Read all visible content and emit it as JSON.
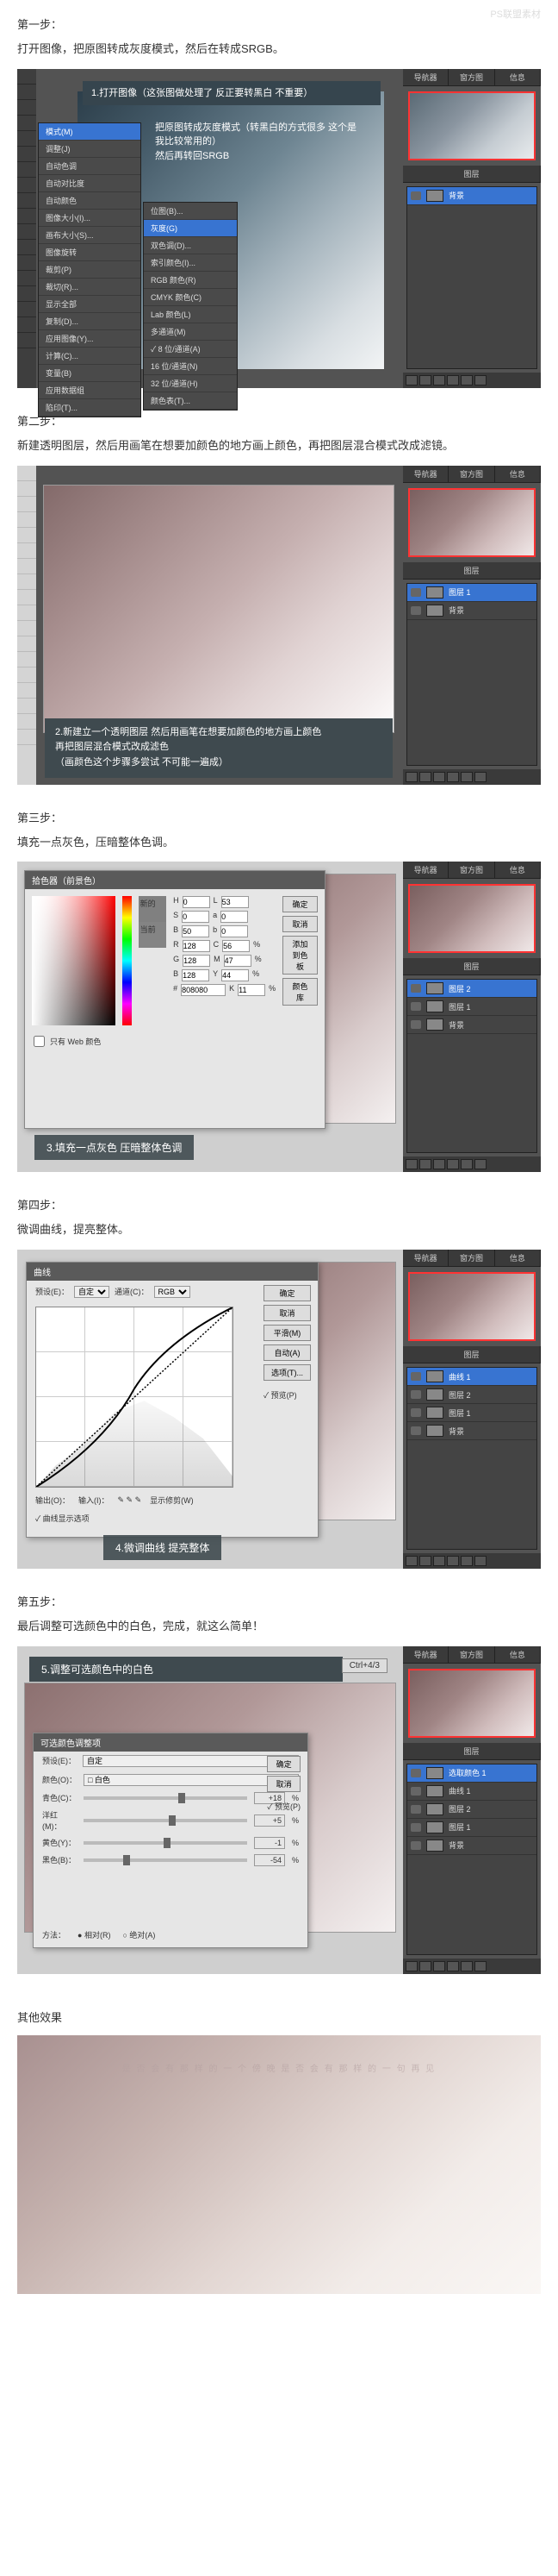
{
  "watermark": "PS联盟素材",
  "steps": [
    {
      "title": "第一步：",
      "desc": "打开图像，把原图转成灰度模式，然后在转成SRGB。",
      "annot1": "1.打开图像（这张图做处理了 反正要转黑白 不重要）",
      "annot2_line1": "把原图转成灰度模式（转黑白的方式很多 这个是我比较常用的）",
      "annot2_line2": "然后再转回SRGB",
      "menu": [
        "模式(M)",
        "调整(J)",
        "自动色调",
        "自动对比度",
        "自动颜色",
        "图像大小(I)...",
        "画布大小(S)...",
        "图像旋转",
        "裁剪(P)",
        "裁切(R)...",
        "显示全部",
        "复制(D)...",
        "应用图像(Y)...",
        "计算(C)...",
        "变量(B)",
        "应用数据组",
        "陷印(T)..."
      ],
      "submenu": [
        "位图(B)...",
        "灰度(G)",
        "双色调(D)...",
        "索引颜色(I)...",
        "RGB 颜色(R)",
        "CMYK 颜色(C)",
        "Lab 颜色(L)",
        "多通道(M)",
        "✓ 8 位/通道(A)",
        "16 位/通道(N)",
        "32 位/通道(H)",
        "颜色表(T)..."
      ],
      "menu_hl_idx": 0,
      "submenu_hl_idx": 1
    },
    {
      "title": "第二步：",
      "desc": "新建透明图层，然后用画笔在想要加颜色的地方画上颜色，再把图层混合模式改成滤镜。",
      "annot_l1": "2.新建立一个透明图层 然后用画笔在想要加颜色的地方画上颜色",
      "annot_l2": "再把图层混合模式改成滤色",
      "annot_l3": "（画颜色这个步骤多尝试 不可能一遍成）"
    },
    {
      "title": "第三步：",
      "desc": "填充一点灰色，压暗整体色调。",
      "annot": "3.填充一点灰色 压暗整体色调",
      "picker": {
        "title": "拾色器（前景色）",
        "new": "新的",
        "current": "当前",
        "btn_ok": "确定",
        "btn_cancel": "取消",
        "btn_add": "添加到色板",
        "btn_lib": "颜色库",
        "hsb": {
          "H": "0",
          "S": "0",
          "B": "50"
        },
        "lab": {
          "L": "53",
          "a": "0",
          "b": "0"
        },
        "rgb": {
          "R": "128",
          "G": "128",
          "B": "128"
        },
        "cmyk": {
          "C": "56",
          "M": "47",
          "Y": "44",
          "K": "11"
        },
        "hex": "808080",
        "webonly": "只有 Web 颜色"
      }
    },
    {
      "title": "第四步：",
      "desc": "微调曲线，提亮整体。",
      "annot": "4.微调曲线 提亮整体",
      "curves": {
        "title": "曲线",
        "preset": "预设(E)：",
        "preset_val": "自定",
        "channel": "通道(C)：",
        "channel_val": "RGB",
        "btn_ok": "确定",
        "btn_cancel": "取消",
        "btn_smooth": "平滑(M)",
        "btn_auto": "自动(A)",
        "btn_options": "选项(T)...",
        "preview": "✓ 预览(P)",
        "output": "输出(O)：",
        "input": "输入(I)：",
        "show_clip": "显示修剪(W)",
        "curve_opts": "✓ 曲线显示选项"
      }
    },
    {
      "title": "第五步：",
      "desc": "最后调整可选颜色中的白色，完成，就这么简单！",
      "annot": "5.调整可选颜色中的白色",
      "shortcut": "Ctrl+4/3",
      "selcolor": {
        "title": "可选颜色调整项",
        "preset": "预设(E)：",
        "preset_val": "自定",
        "colors": "颜色(O)：",
        "colors_val": "□ 白色",
        "sliders": [
          {
            "label": "青色(C)：",
            "val": "+18",
            "pos": 58
          },
          {
            "label": "洋红(M)：",
            "val": "+5",
            "pos": 52
          },
          {
            "label": "黄色(Y)：",
            "val": "-1",
            "pos": 49
          },
          {
            "label": "黑色(B)：",
            "val": "-54",
            "pos": 24
          }
        ],
        "btn_ok": "确定",
        "btn_cancel": "取消",
        "preview": "✓ 预览(P)",
        "method": "方法：",
        "rel": "● 相对(R)",
        "abs": "○ 绝对(A)"
      }
    }
  ],
  "other_title": "其他效果",
  "other_text": "是 否 会 有 那 样 的 一 个 傍 晚 是 否 会 有 那 样 的 一 句 再 见",
  "panel": {
    "tabs": [
      "导航器",
      "窗方图",
      "信息"
    ],
    "layers_title": "图层",
    "layers_s1": [
      {
        "name": "背景",
        "sel": true
      }
    ],
    "layers_s2": [
      {
        "name": "图层 1",
        "sel": true
      },
      {
        "name": "背景",
        "sel": false
      }
    ],
    "layers_s3": [
      {
        "name": "图层 2",
        "sel": true
      },
      {
        "name": "图层 1",
        "sel": false
      },
      {
        "name": "背景",
        "sel": false
      }
    ],
    "layers_s4": [
      {
        "name": "曲线 1",
        "sel": true
      },
      {
        "name": "图层 2",
        "sel": false
      },
      {
        "name": "图层 1",
        "sel": false
      },
      {
        "name": "背景",
        "sel": false
      }
    ],
    "layers_s5": [
      {
        "name": "选取颜色 1",
        "sel": true
      },
      {
        "name": "曲线 1",
        "sel": false
      },
      {
        "name": "图层 2",
        "sel": false
      },
      {
        "name": "图层 1",
        "sel": false
      },
      {
        "name": "背景",
        "sel": false
      }
    ]
  }
}
